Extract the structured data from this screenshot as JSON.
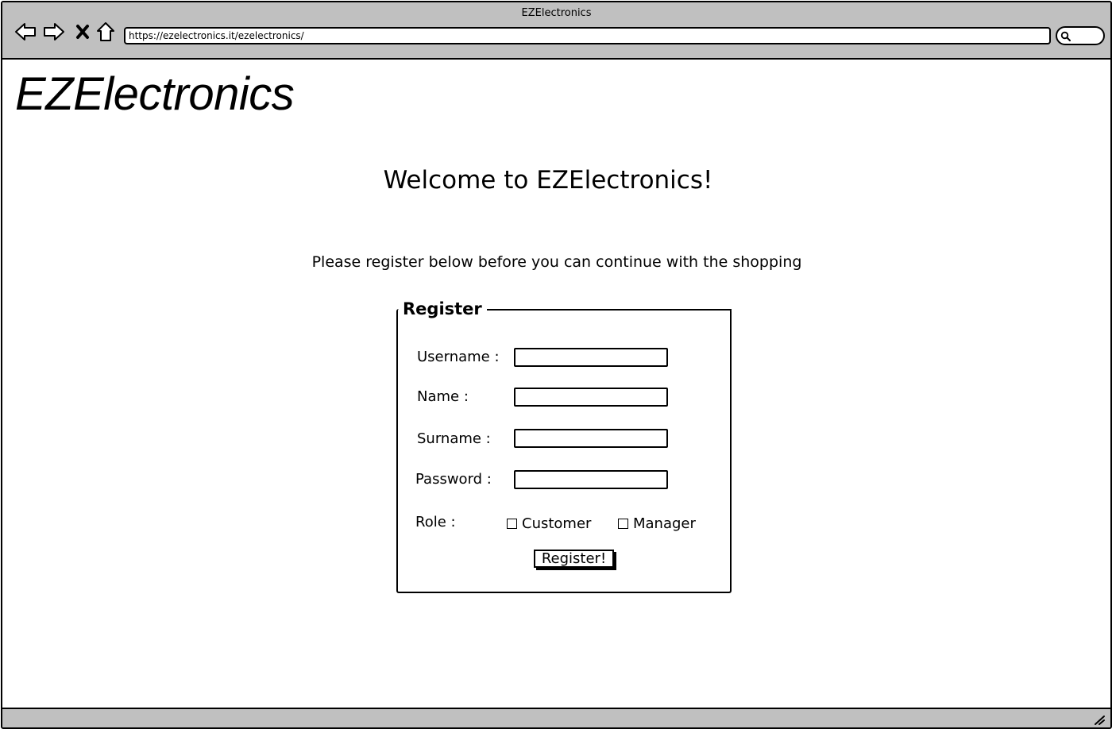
{
  "window": {
    "title": "EZElectronics"
  },
  "toolbar": {
    "back_icon": "back-arrow-icon",
    "forward_icon": "forward-arrow-icon",
    "stop_icon": "close-x-icon",
    "home_icon": "home-icon",
    "url": "https://ezelectronics.it/ezelectronics/",
    "search_icon": "search-icon"
  },
  "page": {
    "logo": "EZElectronics",
    "welcome": "Welcome to EZElectronics!",
    "subtitle": "Please register below before you can continue with the shopping"
  },
  "register_form": {
    "legend": "Register",
    "username_label": "Username :",
    "name_label": "Name :",
    "surname_label": "Surname :",
    "password_label": "Password :",
    "role_label": "Role :",
    "role_customer": "Customer",
    "role_manager": "Manager",
    "submit_label": "Register!"
  }
}
